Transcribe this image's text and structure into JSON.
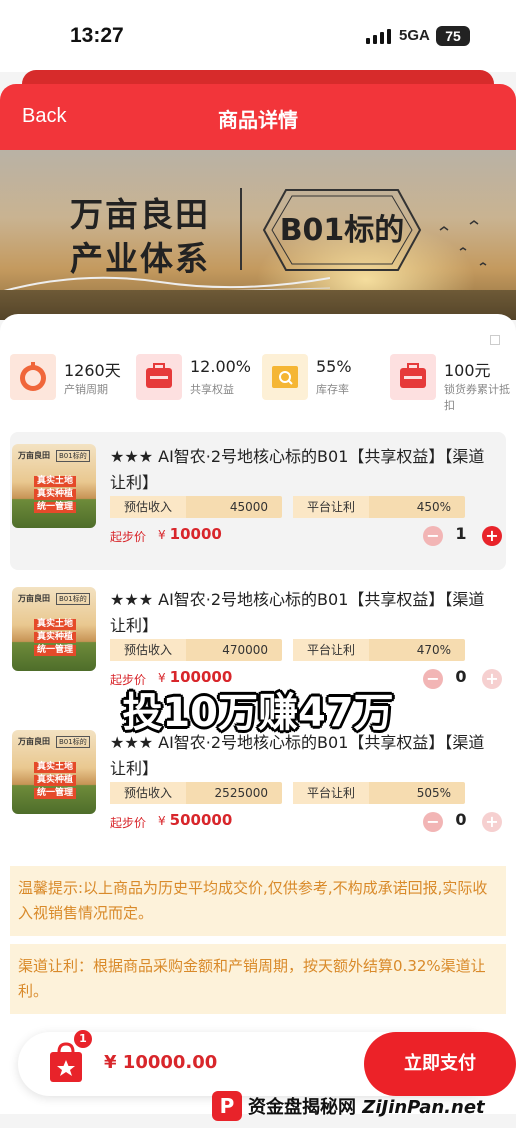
{
  "status_bar": {
    "time": "13:27",
    "network": "5GA",
    "battery": "75"
  },
  "header": {
    "back_label": "Back",
    "title": "商品详情"
  },
  "banner": {
    "line1": "万亩良田",
    "line2": "产业体系",
    "tag": "B01标的"
  },
  "metrics": [
    {
      "value": "1260天",
      "label": "产销周期",
      "icon": "clock-icon"
    },
    {
      "value": "12.00%",
      "label": "共享权益",
      "icon": "briefcase-icon"
    },
    {
      "value": "55%",
      "label": "库存率",
      "icon": "inventory-search-icon"
    },
    {
      "value": "100元",
      "label": "锁货券累计抵扣",
      "icon": "briefcase-icon"
    }
  ],
  "product_thumb": {
    "title": "万亩良田",
    "tag": "B01标的",
    "line1": "真实土地",
    "line2": "真实种植",
    "line3": "统一管理"
  },
  "products": [
    {
      "name": "★★★ AI智农·2号地核心标的B01【共享权益】【渠道让利】",
      "income_label": "预估收入",
      "income": "45000",
      "rebate_label": "平台让利",
      "rebate": "450%",
      "price_label": "起步价",
      "currency": "¥",
      "price": "10000",
      "qty": "1"
    },
    {
      "name": "★★★ AI智农·2号地核心标的B01【共享权益】【渠道让利】",
      "income_label": "预估收入",
      "income": "470000",
      "rebate_label": "平台让利",
      "rebate": "470%",
      "price_label": "起步价",
      "currency": "¥",
      "price": "100000",
      "qty": "0"
    },
    {
      "name": "★★★ AI智农·2号地核心标的B01【共享权益】【渠道让利】",
      "income_label": "预估收入",
      "income": "2525000",
      "rebate_label": "平台让利",
      "rebate": "505%",
      "price_label": "起步价",
      "currency": "¥",
      "price": "500000",
      "qty": "0"
    }
  ],
  "overlay_caption": "投10万赚47万",
  "tips": {
    "tip1": "温馨提示:以上商品为历史平均成交价,仅供参考,不构成承诺回报,实际收入视销售情况而定。",
    "tip2": "渠道让利：根据商品采购金额和产销周期，按天额外结算0.32%渠道让利。"
  },
  "checkout": {
    "badge": "1",
    "total": "¥ 10000.00",
    "pay_label": "立即支付"
  },
  "watermark": {
    "logo": "P",
    "text_cn": "资金盘揭秘网",
    "text_en": "ZiJinPan.net"
  },
  "colors": {
    "primary": "#f2353a",
    "price": "#d8262b",
    "tip_bg": "#fdf2da",
    "tip_text": "#d98a2a"
  }
}
